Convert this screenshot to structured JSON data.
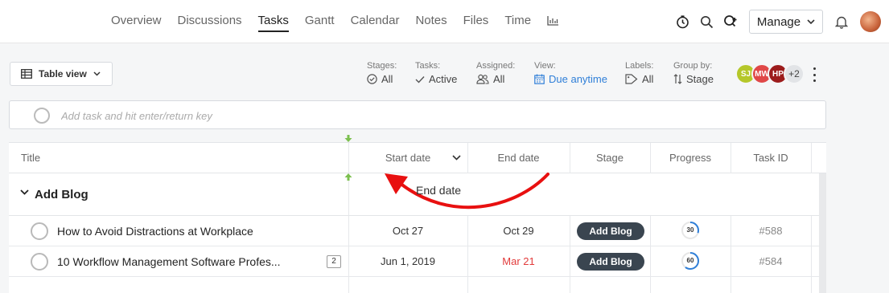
{
  "nav": {
    "tabs": [
      {
        "label": "Overview"
      },
      {
        "label": "Discussions"
      },
      {
        "label": "Tasks"
      },
      {
        "label": "Gantt"
      },
      {
        "label": "Calendar"
      },
      {
        "label": "Notes"
      },
      {
        "label": "Files"
      },
      {
        "label": "Time"
      }
    ],
    "active_tab": "Tasks",
    "reports_icon": "bar-chart-icon",
    "manage_label": "Manage"
  },
  "toolbar": {
    "table_view_label": "Table view",
    "filters": {
      "stages": {
        "label": "Stages:",
        "value": "All",
        "icon": "check-circle-icon"
      },
      "tasks": {
        "label": "Tasks:",
        "value": "Active",
        "icon": "check-icon"
      },
      "assigned": {
        "label": "Assigned:",
        "value": "All",
        "icon": "users-icon"
      },
      "view": {
        "label": "View:",
        "value": "Due anytime",
        "icon": "calendar-icon"
      },
      "labels": {
        "label": "Labels:",
        "value": "All",
        "icon": "tag-icon"
      },
      "group_by": {
        "label": "Group by:",
        "value": "Stage",
        "icon": "sort-icon"
      }
    },
    "members": [
      {
        "initials": "SJ",
        "color": "#b5c72a"
      },
      {
        "initials": "MW",
        "color": "#e04848"
      },
      {
        "initials": "HP",
        "color": "#9c1c1c"
      }
    ],
    "members_more": "+2"
  },
  "add_task": {
    "placeholder": "Add task and hit enter/return key"
  },
  "table": {
    "columns": {
      "title": "Title",
      "start_date": "Start date",
      "end_date": "End date",
      "stage": "Stage",
      "progress": "Progress",
      "task_id": "Task ID"
    },
    "group": {
      "name": "Add Blog"
    },
    "rows": [
      {
        "title": "How to Avoid Distractions at Workplace",
        "start": "Oct 27",
        "end": "Oct 29",
        "end_overdue": false,
        "stage": "Add Blog",
        "progress": 30,
        "task_id": "#588",
        "comments": ""
      },
      {
        "title": "10 Workflow Management Software Profes...",
        "start": "Jun 1, 2019",
        "end": "Mar 21",
        "end_overdue": true,
        "stage": "Add Blog",
        "progress": 60,
        "task_id": "#584",
        "comments": "2"
      }
    ]
  },
  "annotation": {
    "label": "End date",
    "color": "#e81010"
  },
  "colors": {
    "accent_blue": "#2f7fd8",
    "overdue_red": "#e23b3b",
    "stage_pill": "#3a4550",
    "drag_green": "#7cc04f"
  }
}
